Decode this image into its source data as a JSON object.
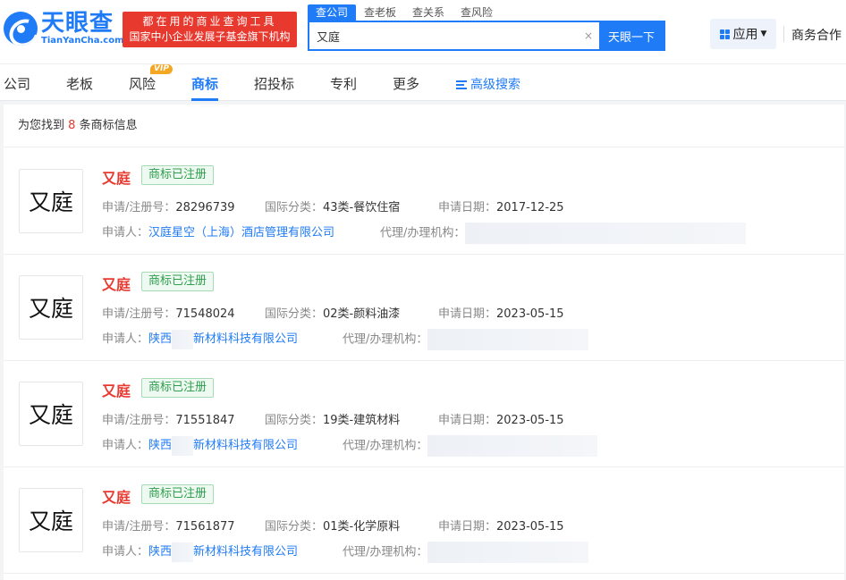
{
  "header": {
    "logo_cn": "天眼查",
    "logo_en": "TianYanCha.com",
    "slogan_line1": "都在用的商业查询工具",
    "slogan_line2": "国家中小企业发展子基金旗下机构",
    "search_tabs": [
      "查公司",
      "查老板",
      "查关系",
      "查风险"
    ],
    "search_value": "又庭",
    "clear_glyph": "×",
    "search_button": "天眼一下",
    "apps_label": "应用",
    "biz_label": "商务合作"
  },
  "nav": {
    "items": [
      "公司",
      "老板",
      "风险",
      "商标",
      "招投标",
      "专利",
      "更多",
      "高级搜索"
    ],
    "vip": "VIP",
    "active": "商标"
  },
  "summary": {
    "prefix": "为您找到",
    "count": "8",
    "suffix": "条商标信息"
  },
  "labels": {
    "reg_no": "申请/注册号：",
    "intl_class": "国际分类：",
    "apply_date": "申请日期：",
    "applicant": "申请人：",
    "agent": "代理/办理机构："
  },
  "results": [
    {
      "image_text": "又庭",
      "name": "又庭",
      "status": "商标已注册",
      "reg_no": "28296739",
      "intl_class": "43类-餐饮住宿",
      "apply_date": "2017-12-25",
      "applicant_a": "汉庭星空（上海）酒店管理有限公司",
      "applicant_b": ""
    },
    {
      "image_text": "又庭",
      "name": "又庭",
      "status": "商标已注册",
      "reg_no": "71548024",
      "intl_class": "02类-颜料油漆",
      "apply_date": "2023-05-15",
      "applicant_a": "陕西",
      "applicant_b": "新材料科技有限公司"
    },
    {
      "image_text": "又庭",
      "name": "又庭",
      "status": "商标已注册",
      "reg_no": "71551847",
      "intl_class": "19类-建筑材料",
      "apply_date": "2023-05-15",
      "applicant_a": "陕西",
      "applicant_b": "新材料科技有限公司"
    },
    {
      "image_text": "又庭",
      "name": "又庭",
      "status": "商标已注册",
      "reg_no": "71561877",
      "intl_class": "01类-化学原料",
      "apply_date": "2023-05-15",
      "applicant_a": "陕西",
      "applicant_b": "新材料科技有限公司"
    }
  ],
  "colors": {
    "brand": "#1f7bf6",
    "accent_red": "#e8392f",
    "status_green": "#2e9e4d"
  }
}
